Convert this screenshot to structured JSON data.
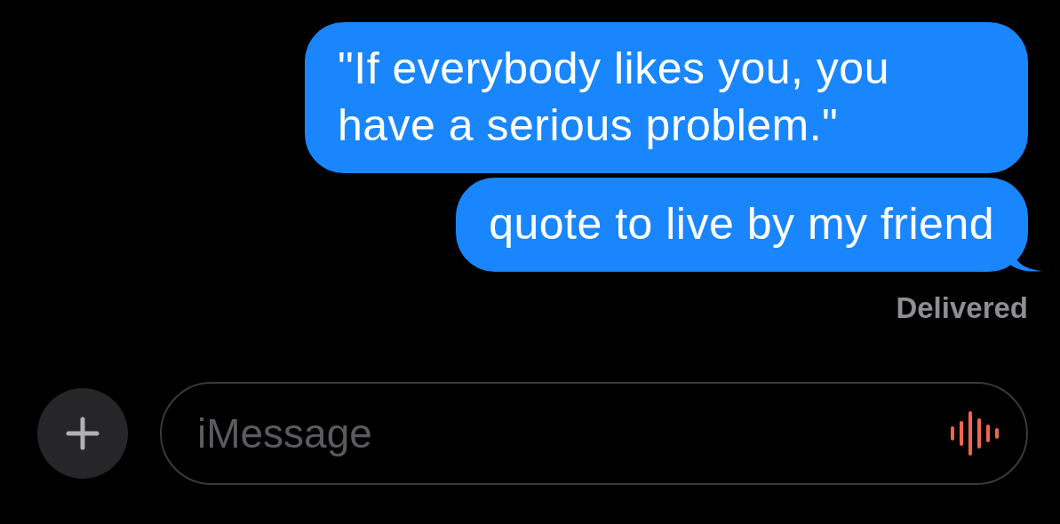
{
  "messages": [
    {
      "text": "\"If everybody likes you, you have a serious problem.\"",
      "kind": "sent",
      "tail": false
    },
    {
      "text": "quote to live by my friend",
      "kind": "sent",
      "tail": true
    }
  ],
  "status": "Delivered",
  "composer": {
    "placeholder": "iMessage"
  }
}
